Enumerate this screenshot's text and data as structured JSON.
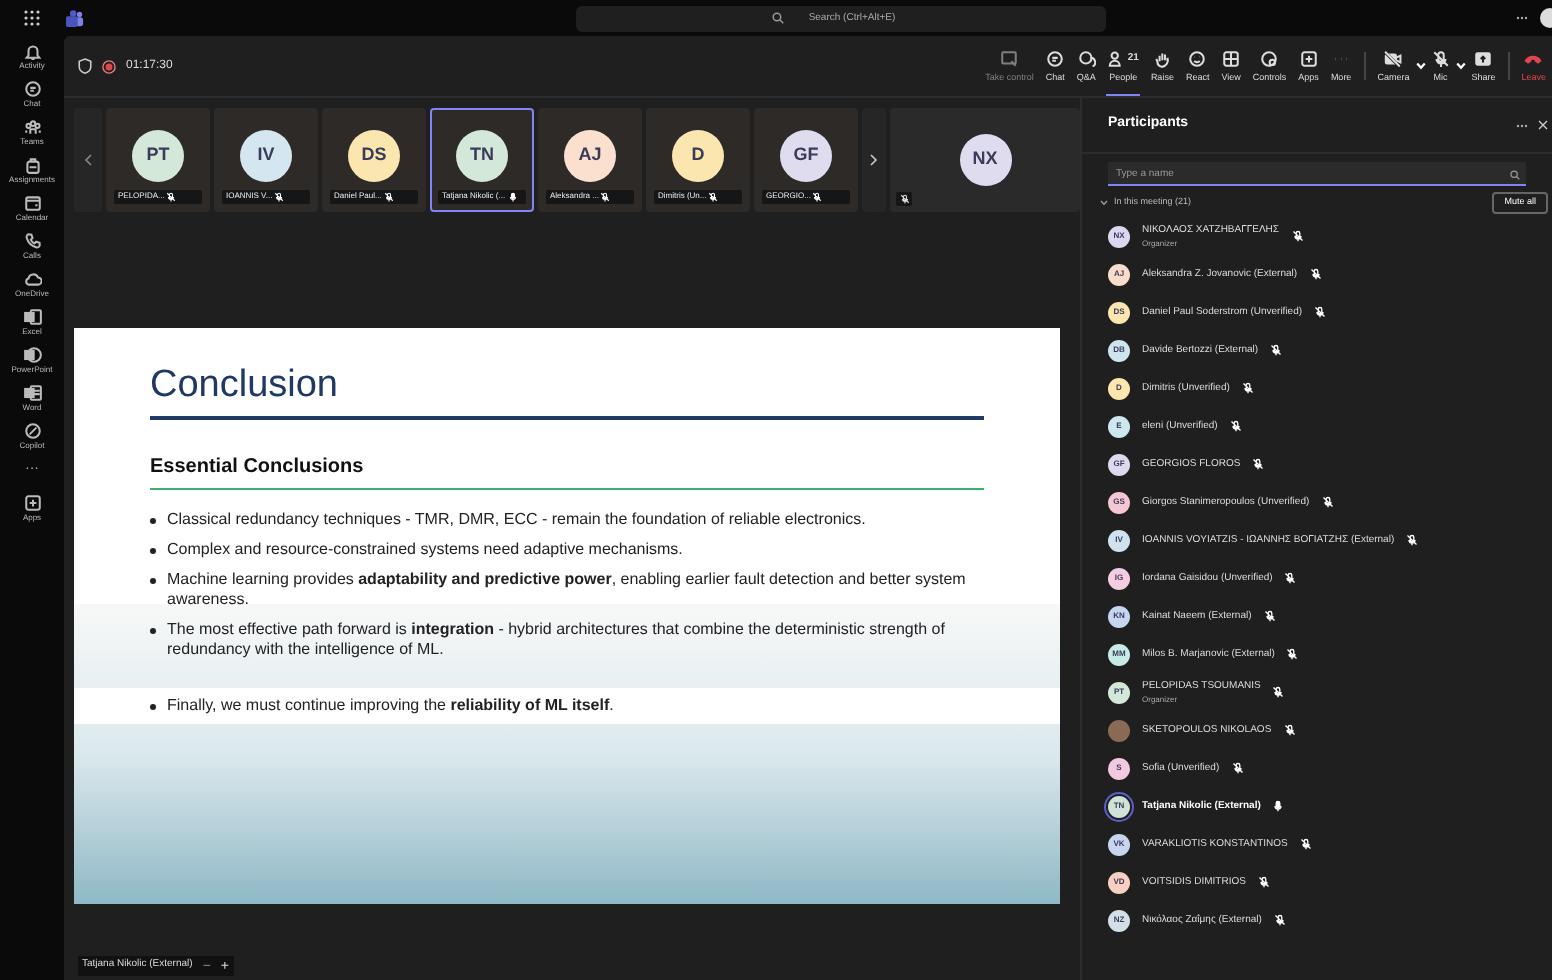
{
  "search": {
    "placeholder": "Search (Ctrl+Alt+E)"
  },
  "rail": [
    {
      "label": "Activity"
    },
    {
      "label": "Chat"
    },
    {
      "label": "Teams"
    },
    {
      "label": "Assignments"
    },
    {
      "label": "Calendar"
    },
    {
      "label": "Calls"
    },
    {
      "label": "OneDrive"
    },
    {
      "label": "Excel"
    },
    {
      "label": "PowerPoint"
    },
    {
      "label": "Word"
    },
    {
      "label": "Copilot"
    },
    {
      "label": "···"
    },
    {
      "label": "Apps"
    }
  ],
  "meeting": {
    "timer": "01:17:30",
    "recording": true
  },
  "toolbar": [
    {
      "label": "Take control",
      "kind": "action",
      "disabled": true,
      "selected": false
    },
    {
      "label": "Chat",
      "kind": "action",
      "disabled": false,
      "selected": false
    },
    {
      "label": "Q&A",
      "kind": "action",
      "disabled": false,
      "selected": false
    },
    {
      "label": "People",
      "kind": "action",
      "disabled": false,
      "selected": true,
      "badge": "21"
    },
    {
      "label": "Raise",
      "kind": "action",
      "disabled": false,
      "selected": false
    },
    {
      "label": "React",
      "kind": "action",
      "disabled": false,
      "selected": false
    },
    {
      "label": "View",
      "kind": "action",
      "disabled": false,
      "selected": false
    },
    {
      "label": "Controls",
      "kind": "action",
      "disabled": false,
      "selected": false
    },
    {
      "label": "Apps",
      "kind": "action",
      "disabled": false,
      "selected": false
    },
    {
      "label": "More",
      "kind": "action",
      "disabled": false,
      "selected": false
    },
    {
      "label": "Camera",
      "kind": "toggle",
      "disabled": false,
      "selected": false,
      "off": true
    },
    {
      "label": "Mic",
      "kind": "toggle",
      "disabled": false,
      "selected": false,
      "off": true
    },
    {
      "label": "Share",
      "kind": "action",
      "disabled": false,
      "selected": false
    },
    {
      "label": "Leave",
      "kind": "leave",
      "disabled": false,
      "selected": false
    }
  ],
  "tiles": [
    {
      "initials": "PT",
      "name": "PELOPIDA...",
      "color": "#d3e8d8",
      "muted": true,
      "selected": false
    },
    {
      "initials": "IV",
      "name": "IOANNIS V...",
      "color": "#d4e6f0",
      "muted": true,
      "selected": false
    },
    {
      "initials": "DS",
      "name": "Daniel Paul...",
      "color": "#fbe6b0",
      "muted": true,
      "selected": false
    },
    {
      "initials": "TN",
      "name": "Tatjana Nikolic (...",
      "color": "#d3e8d8",
      "muted": false,
      "selected": true
    },
    {
      "initials": "AJ",
      "name": "Aleksandra ...",
      "color": "#fbe0cf",
      "muted": true,
      "selected": false
    },
    {
      "initials": "D",
      "name": "Dimitris (Un...",
      "color": "#fbe6b0",
      "muted": true,
      "selected": false
    },
    {
      "initials": "GF",
      "name": "GEORGIO...",
      "color": "#e0dcf0",
      "muted": true,
      "selected": false
    }
  ],
  "featured_tile": {
    "initials": "NX",
    "color": "#e0dcf0",
    "muted": true
  },
  "slide": {
    "title": "Conclusion",
    "subtitle": "Essential Conclusions",
    "bullets": [
      "Classical redundancy techniques - TMR, DMR, ECC - remain the foundation of reliable electronics.",
      "Complex and resource-constrained systems need adaptive mechanisms.",
      "Machine learning provides **adaptability and predictive power**, enabling earlier fault detection and better system awareness.",
      "The most effective path forward is **integration** - hybrid architectures that combine the deterministic strength of redundancy with the intelligence of ML."
    ],
    "final_bullet": "Finally, we must continue improving the **reliability of ML itself**."
  },
  "stage_label": {
    "name": "Tatjana Nikolic (External)",
    "zoom_out": "−",
    "zoom_in": "+"
  },
  "participants": {
    "title": "Participants",
    "search_placeholder": "Type a name",
    "section": "In this meeting (21)",
    "mute_all": "Mute all",
    "people": [
      {
        "initials": "NX",
        "name": "ΝΙΚΟΛΑΟΣ ΧΑΤΖΗΒΑΓΓΕΛΗΣ",
        "role": "Organizer",
        "color": "#ddd6f0",
        "kind": "initials",
        "muted": true,
        "speaking": false
      },
      {
        "initials": "AJ",
        "name": "Aleksandra Z. Jovanovic (External)",
        "color": "#fadccb",
        "kind": "initials",
        "muted": true,
        "speaking": false
      },
      {
        "initials": "DS",
        "name": "Daniel Paul Soderstrom (Unverified)",
        "color": "#fbe6b0",
        "kind": "initials",
        "muted": true,
        "speaking": false
      },
      {
        "initials": "DB",
        "name": "Davide Bertozzi (External)",
        "color": "#cfe5ee",
        "kind": "initials",
        "muted": true,
        "speaking": false
      },
      {
        "initials": "D",
        "name": "Dimitris (Unverified)",
        "color": "#fbe6b0",
        "kind": "initials",
        "muted": true,
        "speaking": false
      },
      {
        "initials": "E",
        "name": "eleni (Unverified)",
        "color": "#cfe8f0",
        "kind": "initials",
        "muted": true,
        "speaking": false
      },
      {
        "initials": "GF",
        "name": "GEORGIOS FLOROS",
        "color": "#ddd9ee",
        "kind": "initials",
        "muted": true,
        "speaking": false
      },
      {
        "initials": "GS",
        "name": "Giorgos Stanimeropoulos (Unverified)",
        "color": "#f5c6d4",
        "kind": "initials",
        "muted": true,
        "speaking": false
      },
      {
        "initials": "IV",
        "name": "IOANNIS VOYIATZIS - ΙΩΑΝΝΗΣ ΒΟΓΙΑΤΖΗΣ (External)",
        "color": "#d0e2ee",
        "kind": "initials",
        "muted": true,
        "speaking": false
      },
      {
        "initials": "IG",
        "name": "Iordana Gaisidou (Unverified)",
        "color": "#f4cde0",
        "kind": "initials",
        "muted": true,
        "speaking": false
      },
      {
        "initials": "KN",
        "name": "Kainat Naeem (External)",
        "color": "#c7d6f0",
        "kind": "initials",
        "muted": true,
        "speaking": false
      },
      {
        "initials": "MM",
        "name": "Milos B. Marjanovic (External)",
        "color": "#c9ebe5",
        "kind": "initials",
        "muted": true,
        "speaking": false
      },
      {
        "initials": "PT",
        "name": "PELOPIDAS TSOUMANIS",
        "role": "Organizer",
        "color": "#d3e8d8",
        "kind": "initials",
        "muted": true,
        "speaking": false
      },
      {
        "name": "SKETOPOULOS NIKOLAOS",
        "color": "#8a6a55",
        "kind": "photo",
        "muted": true,
        "speaking": false
      },
      {
        "initials": "S",
        "name": "Sofia (Unverified)",
        "color": "#f2c9e0",
        "kind": "initials",
        "muted": true,
        "speaking": false
      },
      {
        "initials": "TN",
        "name": "Tatjana Nikolic (External)",
        "color": "#cfe3d8",
        "kind": "initials",
        "muted": false,
        "speaking": true
      },
      {
        "initials": "VK",
        "name": "VARAKLIOTIS KONSTANTINOS",
        "color": "#c7d5f0",
        "kind": "initials",
        "muted": true,
        "speaking": false
      },
      {
        "initials": "VD",
        "name": "VOITSIDIS DIMITRIOS",
        "color": "#f8cfc0",
        "kind": "initials",
        "muted": true,
        "speaking": false
      },
      {
        "initials": "NZ",
        "name": "Νικόλαος Ζαΐμης (External)",
        "color": "#d2dfe6",
        "kind": "initials",
        "muted": true,
        "speaking": false
      }
    ]
  }
}
